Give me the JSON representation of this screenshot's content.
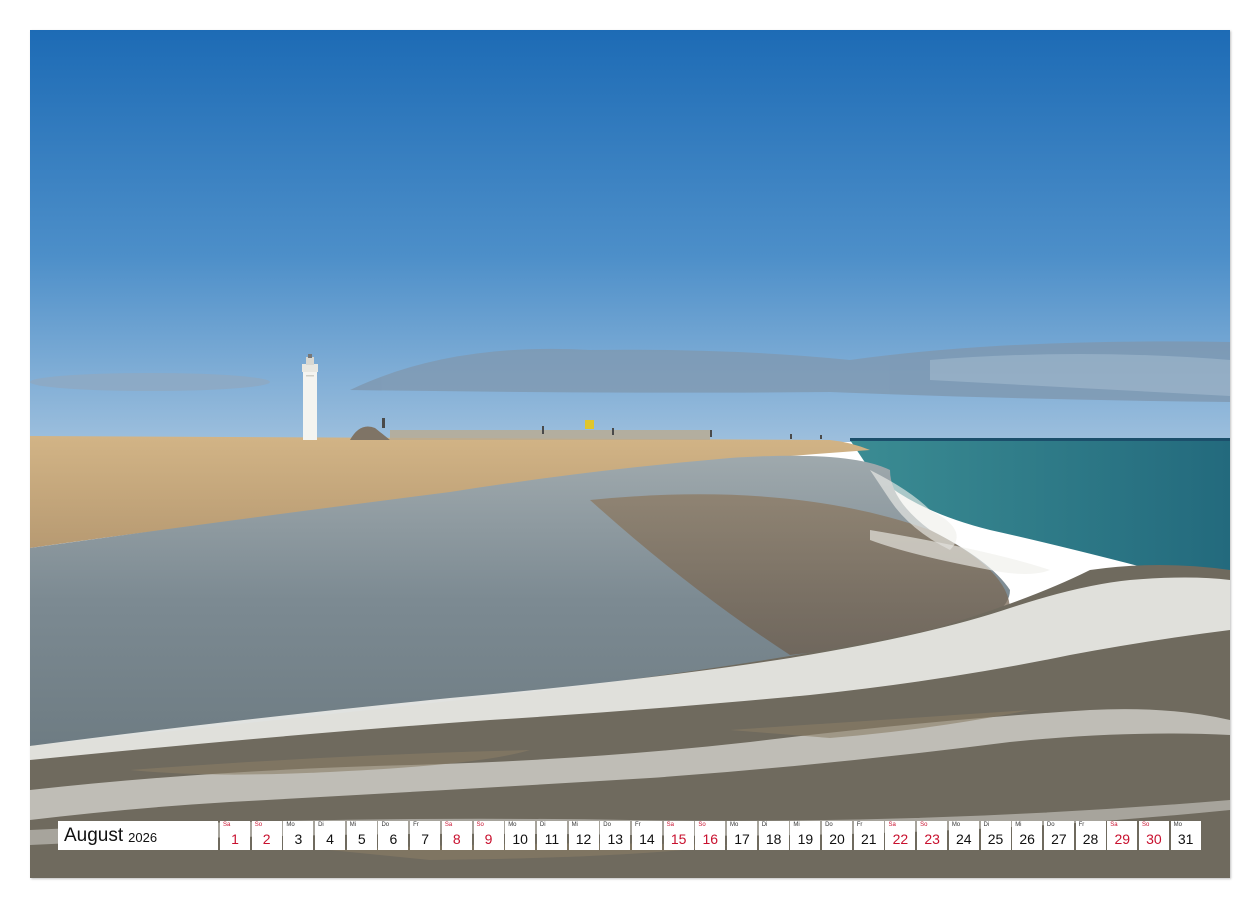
{
  "calendar": {
    "month": "August",
    "year": "2026",
    "weekend_color": "#c8102e",
    "days": [
      {
        "wd": "Sa",
        "num": "1",
        "weekend": true
      },
      {
        "wd": "So",
        "num": "2",
        "weekend": true
      },
      {
        "wd": "Mo",
        "num": "3",
        "weekend": false
      },
      {
        "wd": "Di",
        "num": "4",
        "weekend": false
      },
      {
        "wd": "Mi",
        "num": "5",
        "weekend": false
      },
      {
        "wd": "Do",
        "num": "6",
        "weekend": false
      },
      {
        "wd": "Fr",
        "num": "7",
        "weekend": false
      },
      {
        "wd": "Sa",
        "num": "8",
        "weekend": true
      },
      {
        "wd": "So",
        "num": "9",
        "weekend": true
      },
      {
        "wd": "Mo",
        "num": "10",
        "weekend": false
      },
      {
        "wd": "Di",
        "num": "11",
        "weekend": false
      },
      {
        "wd": "Mi",
        "num": "12",
        "weekend": false
      },
      {
        "wd": "Do",
        "num": "13",
        "weekend": false
      },
      {
        "wd": "Fr",
        "num": "14",
        "weekend": false
      },
      {
        "wd": "Sa",
        "num": "15",
        "weekend": true
      },
      {
        "wd": "So",
        "num": "16",
        "weekend": true
      },
      {
        "wd": "Mo",
        "num": "17",
        "weekend": false
      },
      {
        "wd": "Di",
        "num": "18",
        "weekend": false
      },
      {
        "wd": "Mi",
        "num": "19",
        "weekend": false
      },
      {
        "wd": "Do",
        "num": "20",
        "weekend": false
      },
      {
        "wd": "Fr",
        "num": "21",
        "weekend": false
      },
      {
        "wd": "Sa",
        "num": "22",
        "weekend": true
      },
      {
        "wd": "So",
        "num": "23",
        "weekend": true
      },
      {
        "wd": "Mo",
        "num": "24",
        "weekend": false
      },
      {
        "wd": "Di",
        "num": "25",
        "weekend": false
      },
      {
        "wd": "Mi",
        "num": "26",
        "weekend": false
      },
      {
        "wd": "Do",
        "num": "27",
        "weekend": false
      },
      {
        "wd": "Fr",
        "num": "28",
        "weekend": false
      },
      {
        "wd": "Sa",
        "num": "29",
        "weekend": true
      },
      {
        "wd": "So",
        "num": "30",
        "weekend": true
      },
      {
        "wd": "Mo",
        "num": "31",
        "weekend": false
      }
    ]
  },
  "photo": {
    "subject": "beach-with-lighthouse",
    "colors": {
      "sky_top": "#1f6fb8",
      "sky_bottom": "#8fb6d8",
      "sand": "#c9a878",
      "sea": "#2f7e88",
      "foam": "#f2f2ee"
    }
  },
  "binding": {
    "icon": "spiral-binding-holes"
  }
}
